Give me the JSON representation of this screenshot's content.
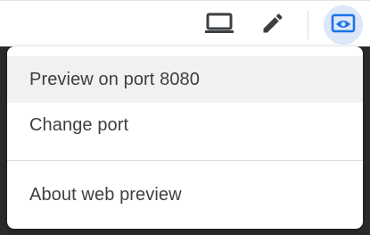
{
  "toolbar": {
    "icons": [
      "laptop-icon",
      "edit-pencil-icon",
      "web-preview-icon"
    ],
    "accent_color": "#1a73e8",
    "active_bg_color": "#dce7f9"
  },
  "menu": {
    "items": [
      {
        "label": "Preview on port 8080"
      },
      {
        "label": "Change port"
      },
      {
        "label": "About web preview"
      }
    ]
  }
}
